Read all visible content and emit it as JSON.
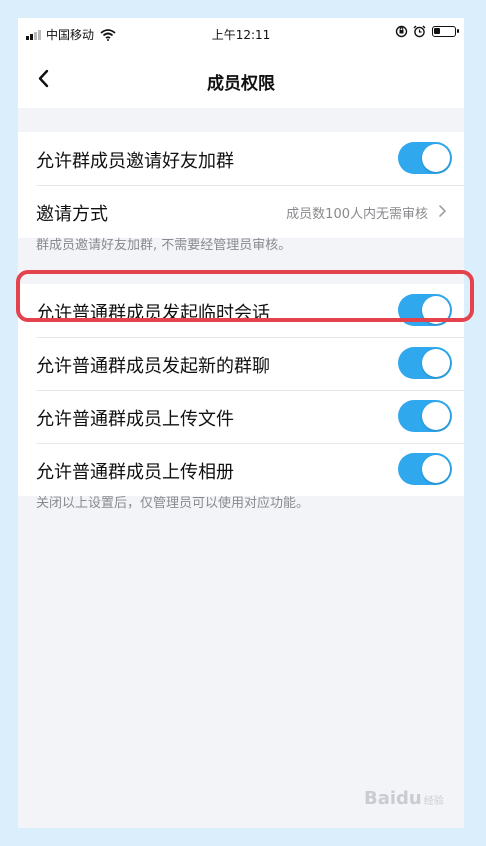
{
  "status_bar": {
    "carrier": "中国移动",
    "time": "上午12:11"
  },
  "nav": {
    "title": "成员权限"
  },
  "group1": {
    "allow_invite_label": "允许群成员邀请好友加群",
    "allow_invite_on": true,
    "invite_method_label": "邀请方式",
    "invite_method_value": "成员数100人内无需审核"
  },
  "hint1": "群成员邀请好友加群, 不需要经管理员审核。",
  "group2": {
    "items": [
      {
        "label": "允许普通群成员发起临时会话",
        "on": true
      },
      {
        "label": "允许普通群成员发起新的群聊",
        "on": true
      },
      {
        "label": "允许普通群成员上传文件",
        "on": true
      },
      {
        "label": "允许普通群成员上传相册",
        "on": true
      }
    ]
  },
  "hint2": "关闭以上设置后，仅管理员可以使用对应功能。",
  "watermark": {
    "brand": "Baidu",
    "sub": "经验"
  },
  "colors": {
    "toggle_on": "#30a8ee",
    "highlight": "#e4434d",
    "page_bg": "#f3f4f8"
  }
}
